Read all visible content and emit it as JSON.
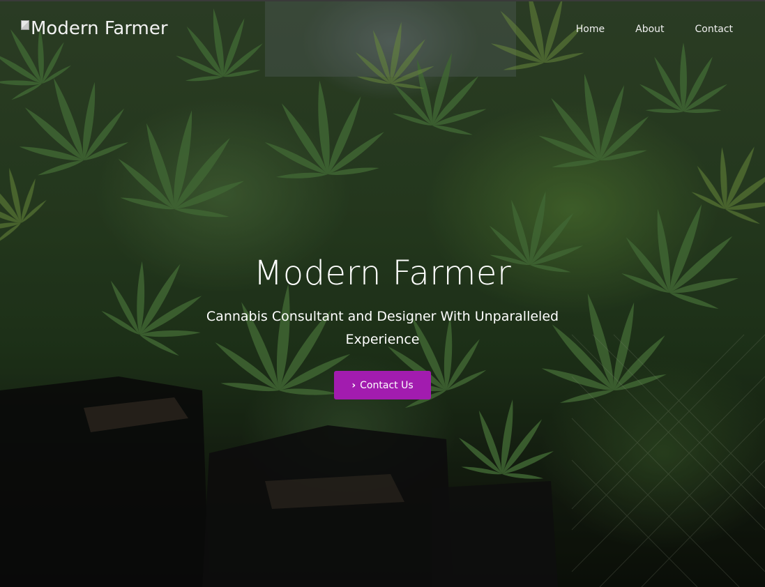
{
  "brand": {
    "logo_alt": "Modern Farmer",
    "logo_icon": "broken-image-icon"
  },
  "nav": {
    "items": [
      {
        "label": "Home"
      },
      {
        "label": "About"
      },
      {
        "label": "Contact"
      }
    ]
  },
  "hero": {
    "title": "Modern Farmer",
    "subtitle": "Cannabis Consultant and Designer With Unparalleled Experience",
    "cta_label": "Contact Us",
    "cta_icon": "chevron-right-icon",
    "background": "cannabis-plants-photo"
  },
  "colors": {
    "accent": "#a21caf",
    "text": "#ffffff"
  }
}
